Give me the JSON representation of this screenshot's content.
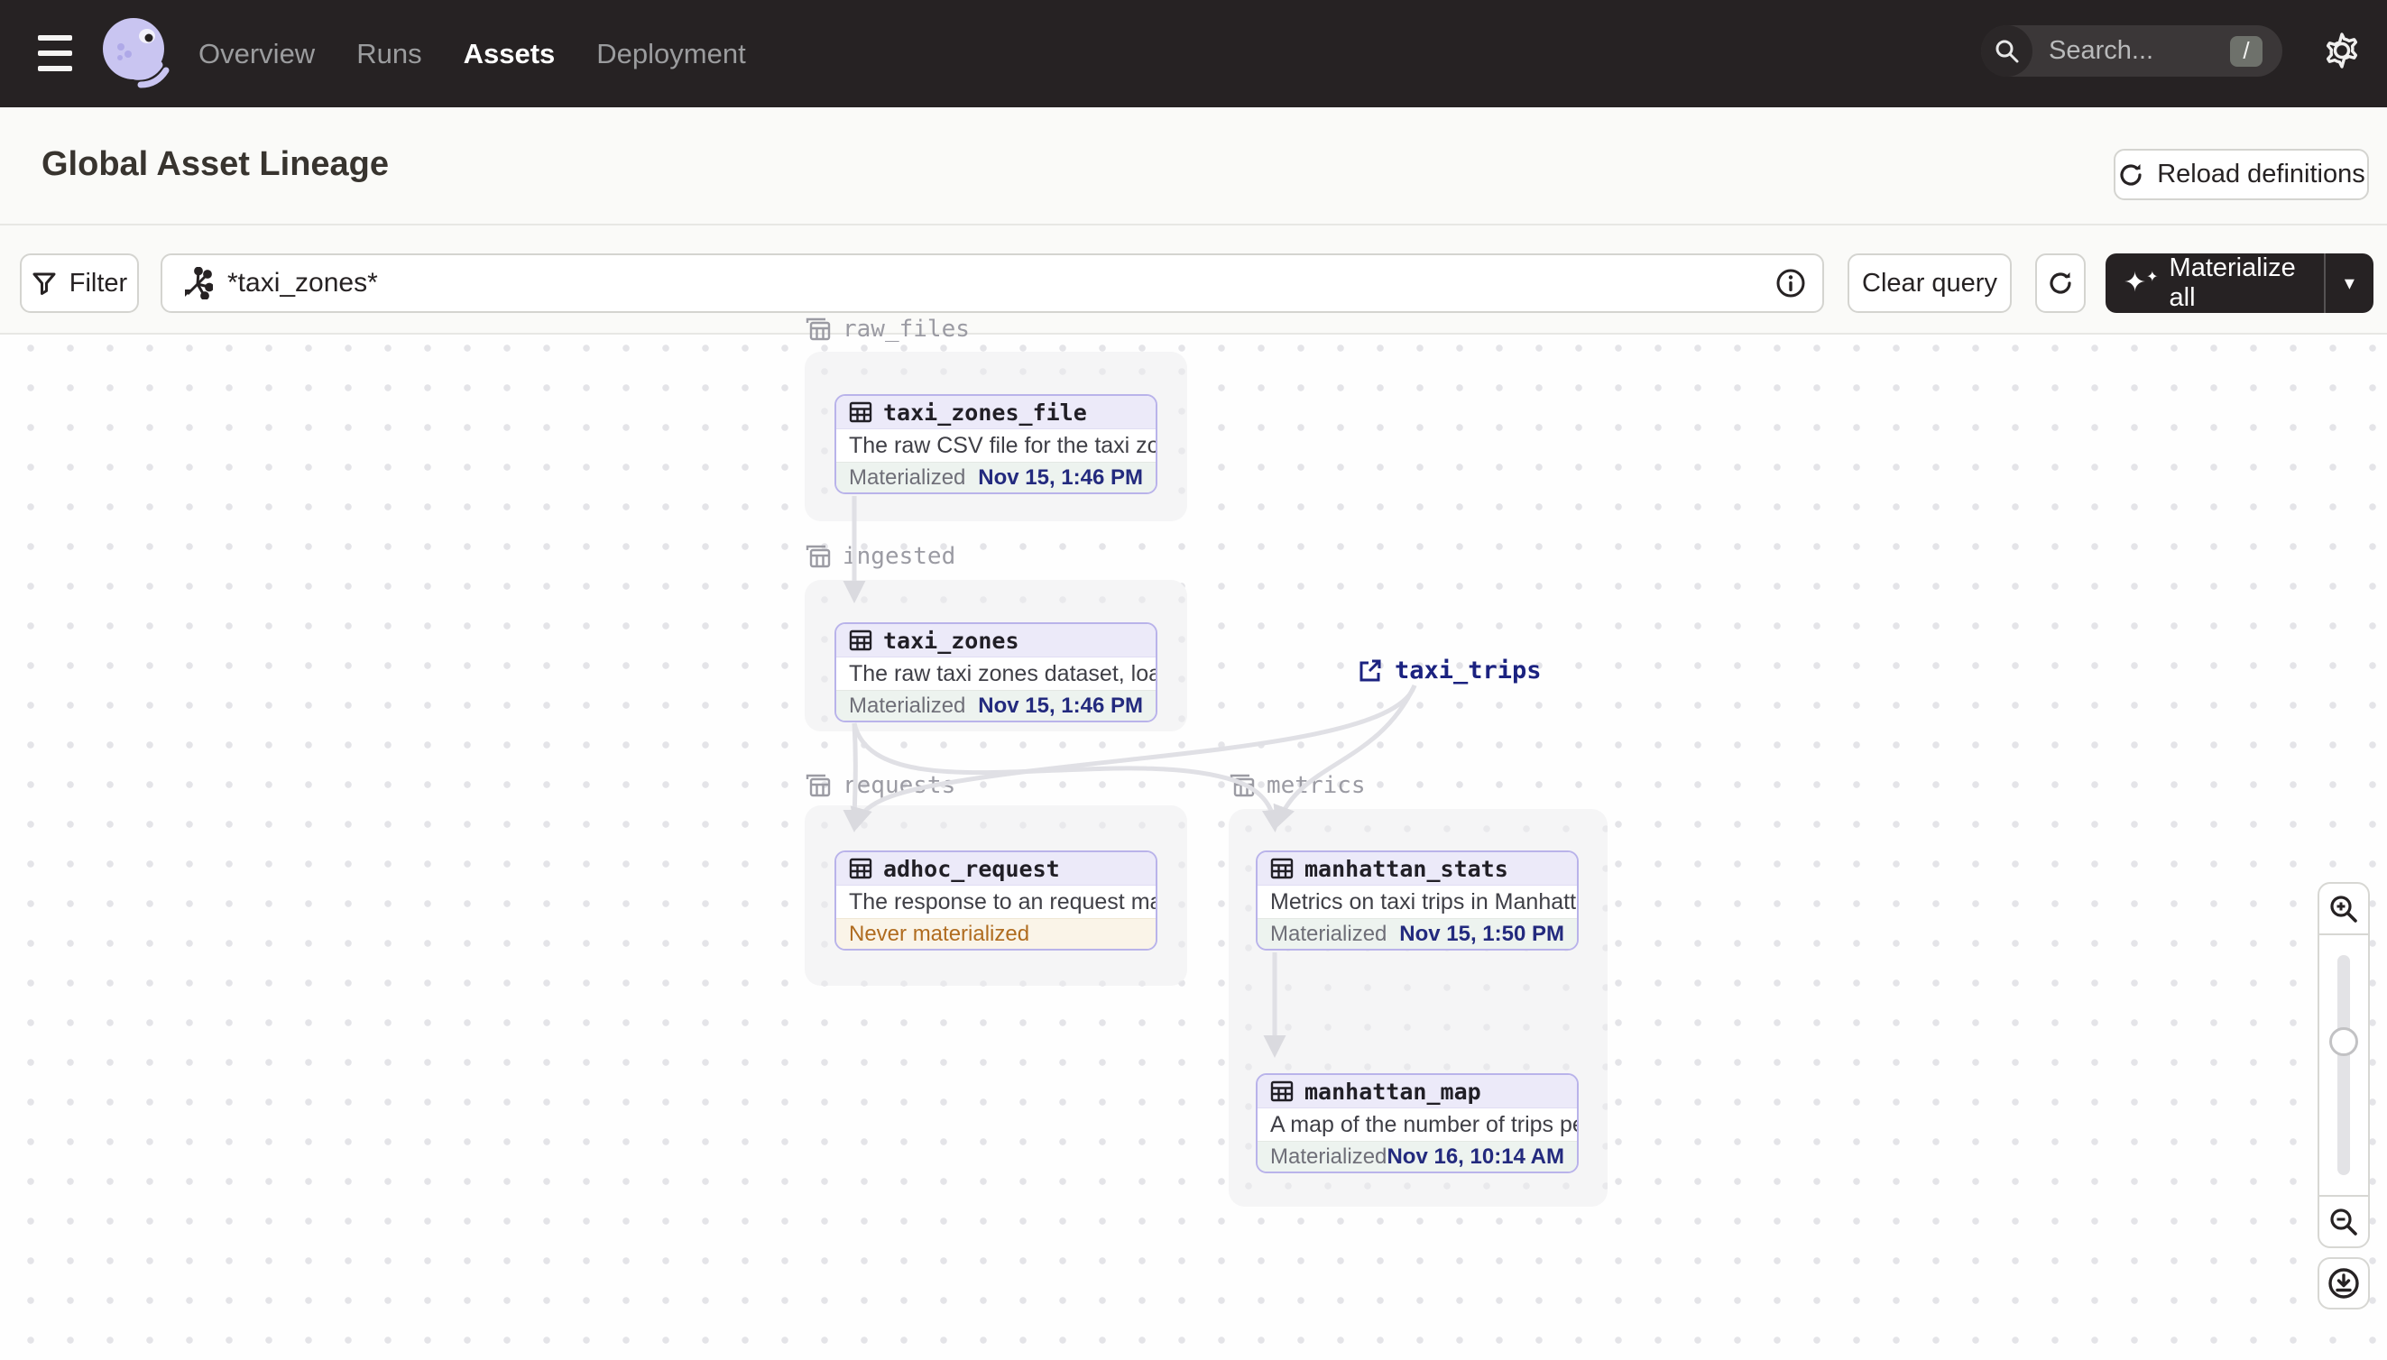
{
  "nav": {
    "items": [
      {
        "label": "Overview",
        "active": false
      },
      {
        "label": "Runs",
        "active": false
      },
      {
        "label": "Assets",
        "active": true
      },
      {
        "label": "Deployment",
        "active": false
      }
    ],
    "search": {
      "placeholder": "Search...",
      "shortcut": "/"
    }
  },
  "header": {
    "title": "Global Asset Lineage",
    "reload_label": "Reload definitions"
  },
  "toolbar": {
    "filter_label": "Filter",
    "query_value": "*taxi_zones*",
    "clear_label": "Clear query",
    "materialize_label": "Materialize all",
    "materialize_caret": "▾",
    "sparkle": "✦",
    "sparkle_small": "✦"
  },
  "graph": {
    "groups": [
      {
        "name": "raw_files"
      },
      {
        "name": "ingested"
      },
      {
        "name": "requests"
      },
      {
        "name": "metrics"
      }
    ],
    "nodes": [
      {
        "name": "taxi_zones_file",
        "group": "raw_files",
        "description": "The raw CSV file for the taxi zones dat...",
        "status": "Materialized",
        "timestamp": "Nov 15, 1:46 PM"
      },
      {
        "name": "taxi_zones",
        "group": "ingested",
        "description": "The raw taxi zones dataset, loaded int...",
        "status": "Materialized",
        "timestamp": "Nov 15, 1:46 PM"
      },
      {
        "name": "adhoc_request",
        "group": "requests",
        "description": "The response to an request made in th...",
        "status": "Never materialized",
        "timestamp": ""
      },
      {
        "name": "manhattan_stats",
        "group": "metrics",
        "description": "Metrics on taxi trips in Manhattan",
        "status": "Materialized",
        "timestamp": "Nov 15, 1:50 PM"
      },
      {
        "name": "manhattan_map",
        "group": "metrics",
        "description": "A map of the number of trips per taxi z...",
        "status": "Materialized",
        "timestamp": "Nov 16, 10:14 AM"
      }
    ],
    "external_assets": [
      {
        "name": "taxi_trips"
      }
    ],
    "edges": [
      {
        "from": "taxi_zones_file",
        "to": "taxi_zones"
      },
      {
        "from": "taxi_zones",
        "to": "adhoc_request"
      },
      {
        "from": "taxi_zones",
        "to": "manhattan_stats"
      },
      {
        "from": "taxi_trips",
        "to": "adhoc_request"
      },
      {
        "from": "taxi_trips",
        "to": "manhattan_stats"
      },
      {
        "from": "manhattan_stats",
        "to": "manhattan_map"
      }
    ]
  },
  "colors": {
    "nav_bg": "#262223",
    "node_border": "#B9B3EA",
    "node_header_bg": "#ECEAF9",
    "materialized_bg": "#EDF3EF",
    "never_materialized_bg": "#FAF4E8",
    "timestamp_text": "#232A7E",
    "never_materialized_text": "#B06C20",
    "edge": "#E3E3E7",
    "external_asset_text": "#1B2280"
  }
}
